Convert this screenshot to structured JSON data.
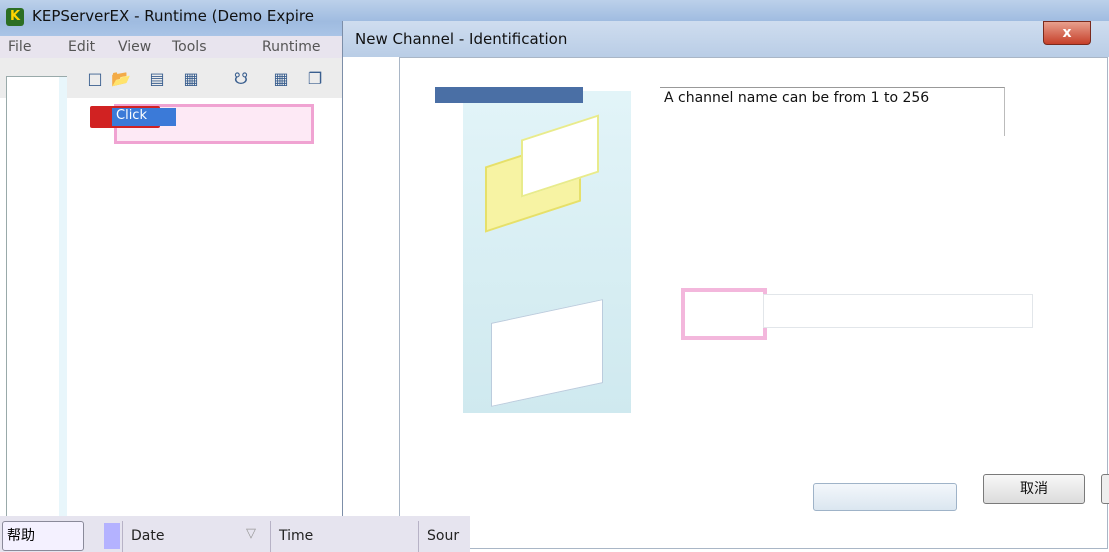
{
  "app": {
    "title": "KEPServerEX - Runtime (Demo Expire",
    "icon_letter": "K"
  },
  "menu": [
    "File",
    "Edit",
    "View",
    "Tools",
    "Runtime"
  ],
  "toolbar_icons": [
    "new-file-icon",
    "open-folder-icon",
    "save-icon",
    "save-as-icon",
    "connect-icon",
    "grid-icon",
    "copy-icon",
    "paste-icon"
  ],
  "tree": {
    "node_label": "Click"
  },
  "dialog": {
    "title": "New Channel - Identification",
    "close_label": "x",
    "description": "A channel name can be from 1 to 256",
    "cancel_label": "取消"
  },
  "statusbar": {
    "help_label": "帮助"
  },
  "log_columns": [
    "Date",
    "Time",
    "Sour"
  ],
  "colors": {
    "close_red": "#c6402a",
    "highlight_pink": "#f0a3d2",
    "selection_blue": "#3b7ad8"
  }
}
